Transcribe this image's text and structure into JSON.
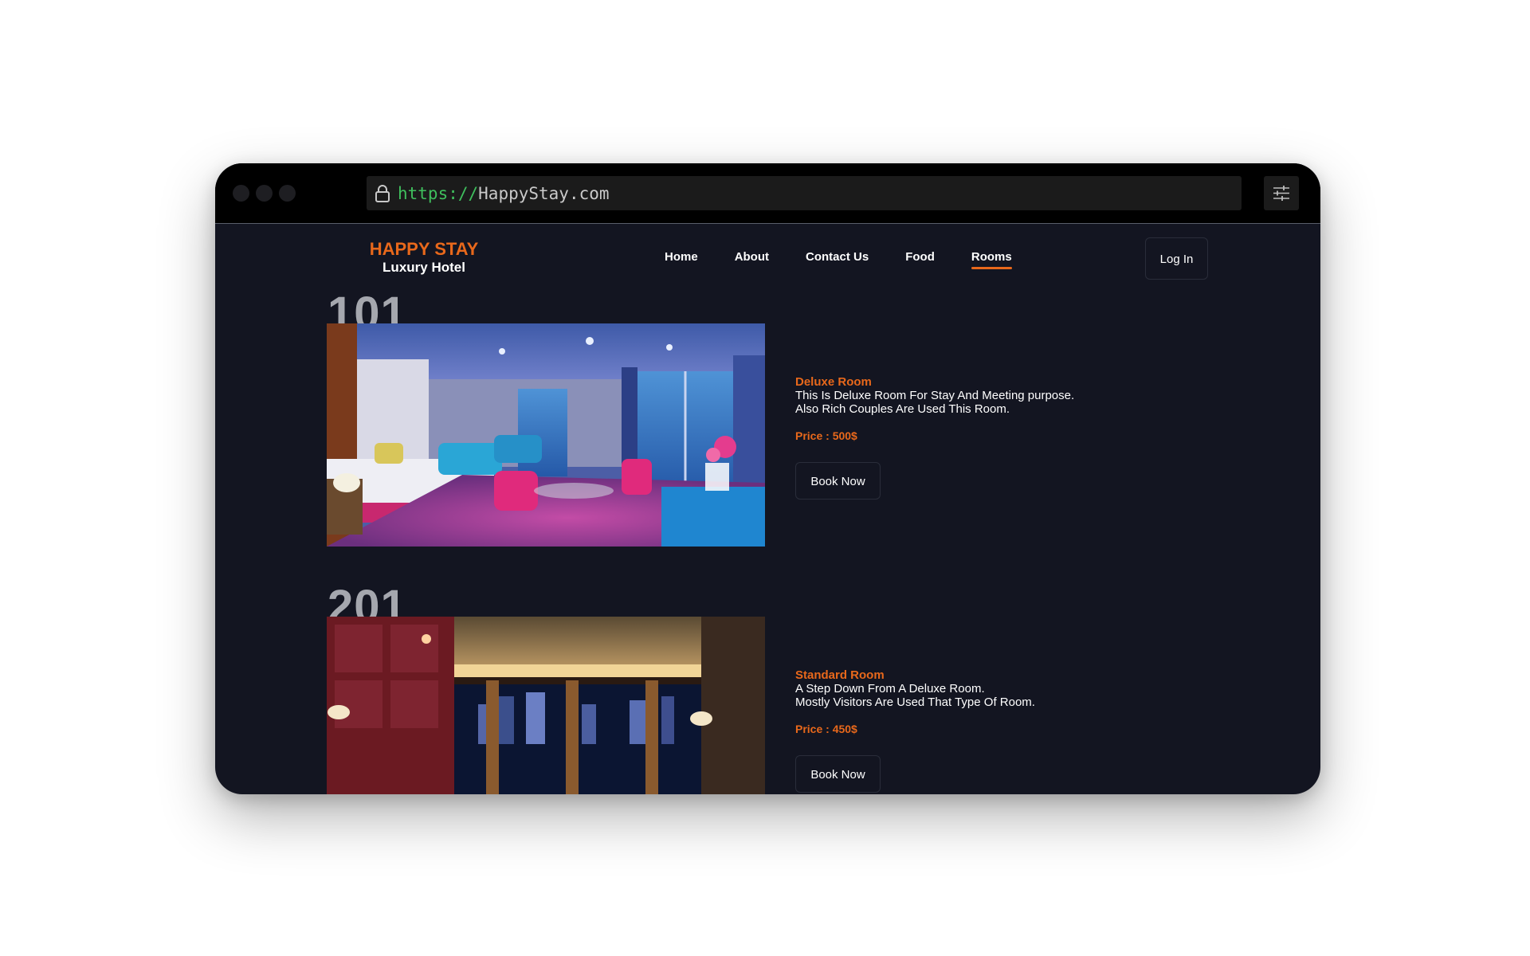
{
  "browser": {
    "url_scheme": "https://",
    "url_host": "HappyStay.com"
  },
  "brand": {
    "name": "HAPPY STAY",
    "tagline": "Luxury Hotel"
  },
  "nav": {
    "items": [
      {
        "label": "Home"
      },
      {
        "label": "About"
      },
      {
        "label": "Contact Us"
      },
      {
        "label": "Food"
      },
      {
        "label": "Rooms",
        "active": true
      }
    ],
    "login_label": "Log In"
  },
  "rooms": [
    {
      "number": "101",
      "title": "Deluxe Room",
      "desc_line1": "This Is Deluxe Room For Stay And Meeting purpose.",
      "desc_line2": "Also Rich Couples Are Used This Room.",
      "price": "Price : 500$",
      "book_label": "Book Now"
    },
    {
      "number": "201",
      "title": "Standard Room",
      "desc_line1": "A Step Down From A Deluxe Room.",
      "desc_line2": "Mostly Visitors Are Used That Type Of Room.",
      "price": "Price : 450$",
      "book_label": "Book Now"
    }
  ],
  "colors": {
    "accent": "#e8681b",
    "page_bg": "#131521",
    "titlebar_bg": "#000000",
    "url_scheme": "#3fbf5d"
  }
}
